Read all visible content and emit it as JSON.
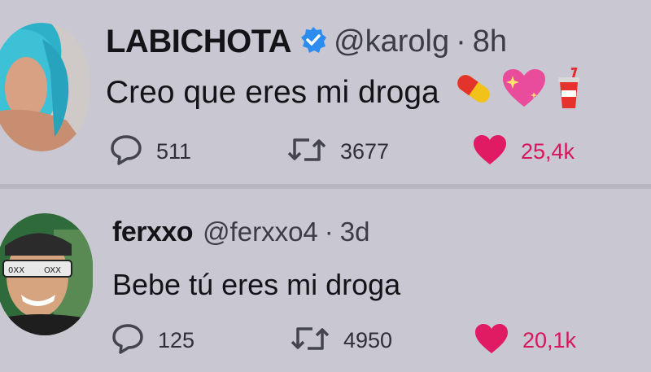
{
  "tweets": [
    {
      "name": "LABICHOTA",
      "verified": true,
      "handle": "@karolg",
      "separator": "·",
      "time": "8h",
      "text": "Creo que eres mi droga",
      "emojis": [
        "pill",
        "sparkling-heart",
        "cup-with-straw"
      ],
      "replies": "511",
      "retweets": "3677",
      "likes": "25,4k"
    },
    {
      "name": "ferxxo",
      "verified": false,
      "handle": "@ferxxo4",
      "separator": "·",
      "time": "3d",
      "text": "Bebe tú eres mi droga",
      "replies": "125",
      "retweets": "4950",
      "likes": "20,1k"
    }
  ],
  "colors": {
    "background": "#c9c8d2",
    "like": "#e01a63",
    "verified": "#2d8cf0",
    "icon": "#44444e"
  }
}
